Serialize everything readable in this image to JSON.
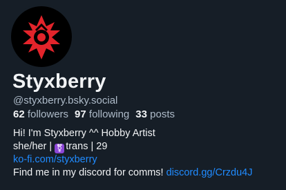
{
  "profile": {
    "display_name": "Styxberry",
    "handle": "@styxberry.bsky.social",
    "avatar_icon": "red-sigil-emblem",
    "stats": {
      "followers_count": "62",
      "followers_label": "followers",
      "following_count": "97",
      "following_label": "following",
      "posts_count": "33",
      "posts_label": "posts"
    },
    "bio": {
      "line1": "Hi! I'm Styxberry ^^ Hobby Artist",
      "line2_a": "she/her | ",
      "line2_emoji": "⚧",
      "line2_b": "trans | 29",
      "link1": "ko-fi.com/styxberry",
      "line4_text": "Find me in my discord for comms! ",
      "link2": "discord.gg/Crzdu4J"
    }
  },
  "colors": {
    "background": "#161e27",
    "text": "#f1f3f5",
    "muted": "#aebbc9",
    "link": "#208bfe",
    "emblem": "#e3242b"
  }
}
